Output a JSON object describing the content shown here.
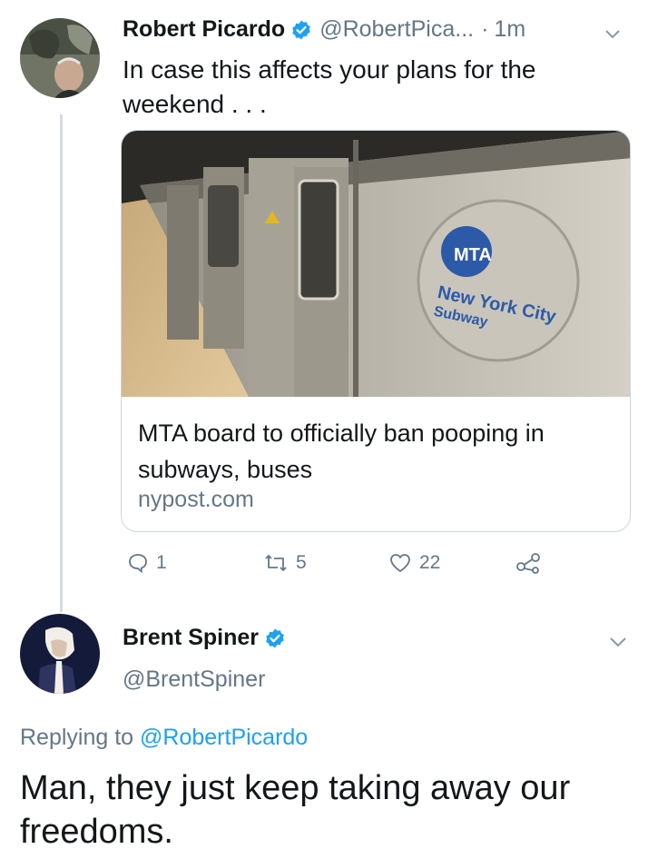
{
  "tweet": {
    "author_name": "Robert Picardo",
    "author_handle": "@RobertPica...",
    "separator": "·",
    "timestamp": "1m",
    "text": "In case this affects your plans for the weekend . . .",
    "card": {
      "title": "MTA board to officially ban pooping in subways, buses",
      "domain": "nypost.com",
      "image_text": {
        "logo": "MTA",
        "line1": "New York City",
        "line2": "Subway"
      }
    },
    "actions": {
      "reply_icon": "reply-icon",
      "reply_count": "1",
      "retweet_icon": "retweet-icon",
      "retweet_count": "5",
      "like_icon": "heart-icon",
      "like_count": "22",
      "share_icon": "share-icon"
    }
  },
  "reply": {
    "author_name": "Brent Spiner",
    "author_handle": "@BrentSpiner",
    "replying_prefix": "Replying to",
    "replying_to": "@RobertPicardo",
    "text": "Man, they just keep taking away our freedoms."
  },
  "colors": {
    "text": "#14171a",
    "secondary": "#657786",
    "accent": "#1da1f2",
    "border": "#ccd6dd",
    "mta_blue": "#2c5aa8"
  }
}
